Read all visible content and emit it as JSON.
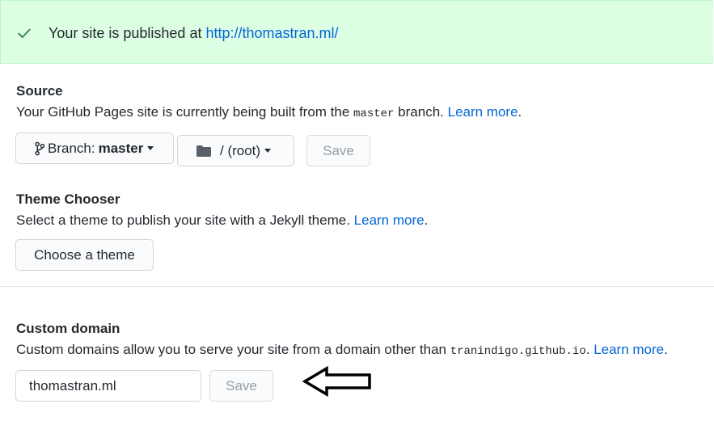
{
  "banner": {
    "prefix": "Your site is published at ",
    "url": "http://thomastran.ml/",
    "icon": "check-icon",
    "bg_color": "#dcffe4"
  },
  "source": {
    "heading": "Source",
    "desc_before": "Your GitHub Pages site is currently being built from the ",
    "branch_code": "master",
    "desc_after": " branch. ",
    "learn_more": "Learn more",
    "period": ".",
    "branch_button": {
      "label_prefix": "Branch: ",
      "label_value": "master",
      "icon": "git-branch-icon"
    },
    "folder_button": {
      "label": "/ (root)",
      "icon": "folder-icon"
    },
    "save_label": "Save"
  },
  "theme": {
    "heading": "Theme Chooser",
    "desc": "Select a theme to publish your site with a Jekyll theme. ",
    "learn_more": "Learn more",
    "period": ".",
    "button_label": "Choose a theme"
  },
  "custom_domain": {
    "heading": "Custom domain",
    "desc_before": "Custom domains allow you to serve your site from a domain other than ",
    "domain_code": "tranindigo.github.io",
    "desc_after": ". ",
    "learn_more": "Learn more",
    "period": ".",
    "input_value": "thomastran.ml",
    "save_label": "Save"
  },
  "annotation": {
    "icon": "left-arrow-icon"
  },
  "colors": {
    "link": "#0366d6",
    "success_green": "#28a745",
    "text": "#24292e"
  }
}
